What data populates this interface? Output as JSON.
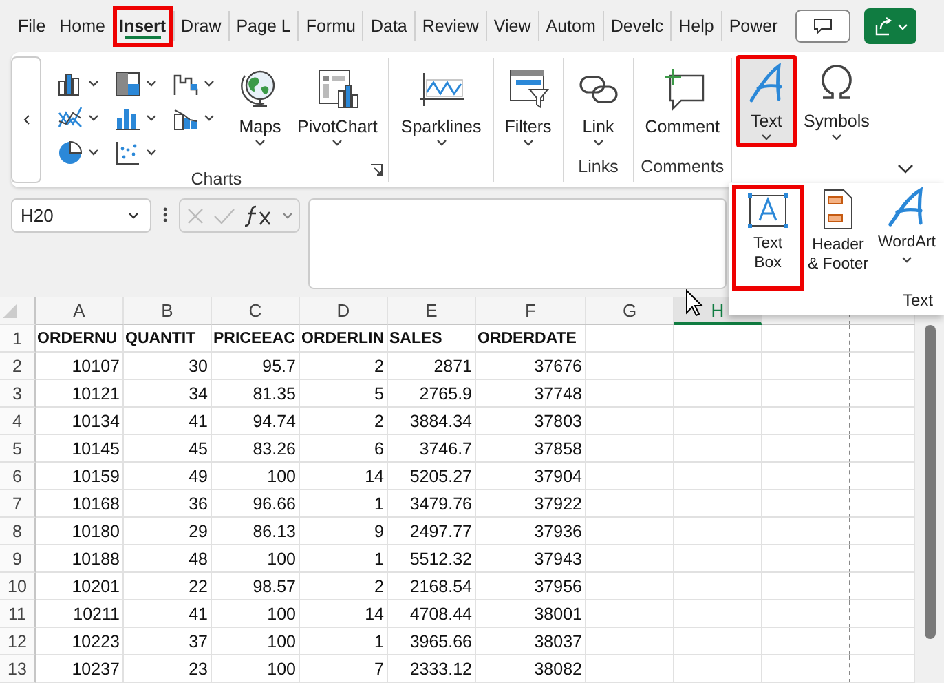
{
  "tabs": [
    {
      "label": "File",
      "selected": false,
      "highlighted": false
    },
    {
      "label": "Home",
      "selected": false,
      "highlighted": false
    },
    {
      "label": "Insert",
      "selected": true,
      "highlighted": true
    },
    {
      "label": "Draw",
      "selected": false,
      "highlighted": false
    },
    {
      "label": "Page L",
      "selected": false,
      "highlighted": false
    },
    {
      "label": "Formu",
      "selected": false,
      "highlighted": false
    },
    {
      "label": "Data",
      "selected": false,
      "highlighted": false
    },
    {
      "label": "Review",
      "selected": false,
      "highlighted": false
    },
    {
      "label": "View",
      "selected": false,
      "highlighted": false
    },
    {
      "label": "Autom",
      "selected": false,
      "highlighted": false
    },
    {
      "label": "Develc",
      "selected": false,
      "highlighted": false
    },
    {
      "label": "Help",
      "selected": false,
      "highlighted": false
    },
    {
      "label": "Power",
      "selected": false,
      "highlighted": false
    }
  ],
  "ribbon": {
    "groups": [
      {
        "label": "Charts",
        "buttons": [
          {
            "label": "Maps",
            "kind": "maps",
            "dropdown": true,
            "selected": false,
            "highlighted": false
          },
          {
            "label": "PivotChart",
            "kind": "pivotchart",
            "dropdown": true,
            "selected": false,
            "highlighted": false
          }
        ]
      },
      {
        "buttons": [
          {
            "label": "Sparklines",
            "kind": "sparklines",
            "dropdown": true,
            "selected": false,
            "highlighted": false
          }
        ]
      },
      {
        "buttons": [
          {
            "label": "Filters",
            "kind": "filters",
            "dropdown": true,
            "selected": false,
            "highlighted": false
          }
        ]
      },
      {
        "label": "Links",
        "buttons": [
          {
            "label": "Link",
            "kind": "link",
            "dropdown": true,
            "selected": false,
            "highlighted": false
          }
        ]
      },
      {
        "label": "Comments",
        "buttons": [
          {
            "label": "Comment",
            "kind": "comment",
            "dropdown": false,
            "selected": false,
            "highlighted": false
          }
        ]
      },
      {
        "buttons": [
          {
            "label": "Text",
            "kind": "text",
            "dropdown": true,
            "selected": true,
            "highlighted": true
          },
          {
            "label": "Symbols",
            "kind": "symbols",
            "dropdown": true,
            "selected": false,
            "highlighted": false
          }
        ]
      }
    ]
  },
  "formula_bar": {
    "name_box": "H20"
  },
  "text_menu": {
    "title": "Text",
    "items": [
      {
        "label": "Text Box",
        "kind": "textbox",
        "highlighted": true
      },
      {
        "label": "Header & Footer",
        "kind": "headerfooter",
        "highlighted": false
      },
      {
        "label": "WordArt",
        "kind": "wordart",
        "highlighted": false
      }
    ]
  },
  "sheet": {
    "columns": [
      {
        "label": "A",
        "selected": false
      },
      {
        "label": "B",
        "selected": false
      },
      {
        "label": "C",
        "selected": false
      },
      {
        "label": "D",
        "selected": false
      },
      {
        "label": "E",
        "selected": false
      },
      {
        "label": "F",
        "selected": false
      },
      {
        "label": "G",
        "selected": false
      },
      {
        "label": "H",
        "selected": true
      }
    ],
    "rows": [
      {
        "number": "1",
        "kind": "header",
        "cells": [
          "ORDERNU",
          "QUANTIT",
          "PRICEEAC",
          "ORDERLIN",
          "SALES",
          "ORDERDATE"
        ]
      },
      {
        "number": "2",
        "kind": "data",
        "cells": [
          "10107",
          "30",
          "95.7",
          "2",
          "2871",
          "37676"
        ]
      },
      {
        "number": "3",
        "kind": "data",
        "cells": [
          "10121",
          "34",
          "81.35",
          "5",
          "2765.9",
          "37748"
        ]
      },
      {
        "number": "4",
        "kind": "data",
        "cells": [
          "10134",
          "41",
          "94.74",
          "2",
          "3884.34",
          "37803"
        ]
      },
      {
        "number": "5",
        "kind": "data",
        "cells": [
          "10145",
          "45",
          "83.26",
          "6",
          "3746.7",
          "37858"
        ]
      },
      {
        "number": "6",
        "kind": "data",
        "cells": [
          "10159",
          "49",
          "100",
          "14",
          "5205.27",
          "37904"
        ]
      },
      {
        "number": "7",
        "kind": "data",
        "cells": [
          "10168",
          "36",
          "96.66",
          "1",
          "3479.76",
          "37922"
        ]
      },
      {
        "number": "8",
        "kind": "data",
        "cells": [
          "10180",
          "29",
          "86.13",
          "9",
          "2497.77",
          "37936"
        ]
      },
      {
        "number": "9",
        "kind": "data",
        "cells": [
          "10188",
          "48",
          "100",
          "1",
          "5512.32",
          "37943"
        ]
      },
      {
        "number": "10",
        "kind": "data",
        "cells": [
          "10201",
          "22",
          "98.57",
          "2",
          "2168.54",
          "37956"
        ]
      },
      {
        "number": "11",
        "kind": "data",
        "cells": [
          "10211",
          "41",
          "100",
          "14",
          "4708.44",
          "38001"
        ]
      },
      {
        "number": "12",
        "kind": "data",
        "cells": [
          "10223",
          "37",
          "100",
          "1",
          "3965.66",
          "38037"
        ]
      },
      {
        "number": "13",
        "kind": "data",
        "cells": [
          "10237",
          "23",
          "100",
          "7",
          "2333.12",
          "38082"
        ]
      }
    ]
  }
}
